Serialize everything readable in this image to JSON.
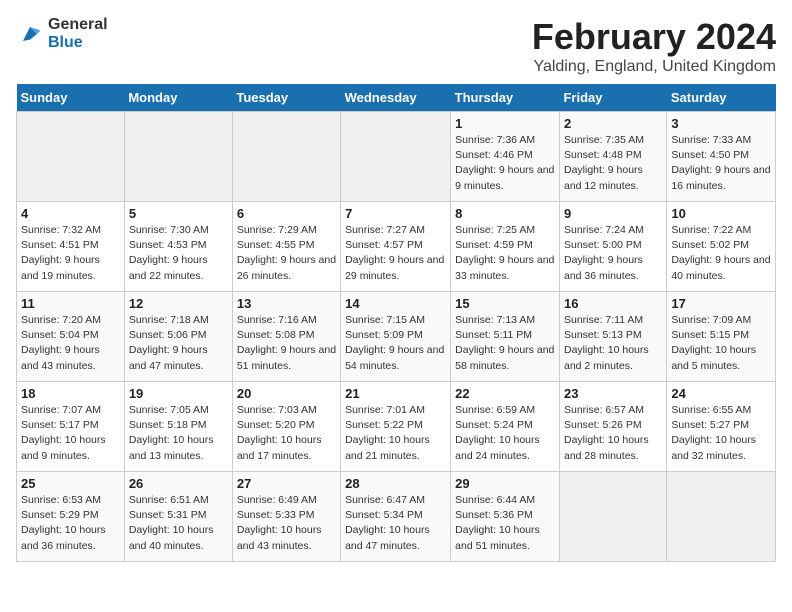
{
  "logo": {
    "line1": "General",
    "line2": "Blue"
  },
  "title": "February 2024",
  "subtitle": "Yalding, England, United Kingdom",
  "days_of_week": [
    "Sunday",
    "Monday",
    "Tuesday",
    "Wednesday",
    "Thursday",
    "Friday",
    "Saturday"
  ],
  "weeks": [
    [
      {
        "day": "",
        "info": ""
      },
      {
        "day": "",
        "info": ""
      },
      {
        "day": "",
        "info": ""
      },
      {
        "day": "",
        "info": ""
      },
      {
        "day": "1",
        "info": "Sunrise: 7:36 AM\nSunset: 4:46 PM\nDaylight: 9 hours and 9 minutes."
      },
      {
        "day": "2",
        "info": "Sunrise: 7:35 AM\nSunset: 4:48 PM\nDaylight: 9 hours and 12 minutes."
      },
      {
        "day": "3",
        "info": "Sunrise: 7:33 AM\nSunset: 4:50 PM\nDaylight: 9 hours and 16 minutes."
      }
    ],
    [
      {
        "day": "4",
        "info": "Sunrise: 7:32 AM\nSunset: 4:51 PM\nDaylight: 9 hours and 19 minutes."
      },
      {
        "day": "5",
        "info": "Sunrise: 7:30 AM\nSunset: 4:53 PM\nDaylight: 9 hours and 22 minutes."
      },
      {
        "day": "6",
        "info": "Sunrise: 7:29 AM\nSunset: 4:55 PM\nDaylight: 9 hours and 26 minutes."
      },
      {
        "day": "7",
        "info": "Sunrise: 7:27 AM\nSunset: 4:57 PM\nDaylight: 9 hours and 29 minutes."
      },
      {
        "day": "8",
        "info": "Sunrise: 7:25 AM\nSunset: 4:59 PM\nDaylight: 9 hours and 33 minutes."
      },
      {
        "day": "9",
        "info": "Sunrise: 7:24 AM\nSunset: 5:00 PM\nDaylight: 9 hours and 36 minutes."
      },
      {
        "day": "10",
        "info": "Sunrise: 7:22 AM\nSunset: 5:02 PM\nDaylight: 9 hours and 40 minutes."
      }
    ],
    [
      {
        "day": "11",
        "info": "Sunrise: 7:20 AM\nSunset: 5:04 PM\nDaylight: 9 hours and 43 minutes."
      },
      {
        "day": "12",
        "info": "Sunrise: 7:18 AM\nSunset: 5:06 PM\nDaylight: 9 hours and 47 minutes."
      },
      {
        "day": "13",
        "info": "Sunrise: 7:16 AM\nSunset: 5:08 PM\nDaylight: 9 hours and 51 minutes."
      },
      {
        "day": "14",
        "info": "Sunrise: 7:15 AM\nSunset: 5:09 PM\nDaylight: 9 hours and 54 minutes."
      },
      {
        "day": "15",
        "info": "Sunrise: 7:13 AM\nSunset: 5:11 PM\nDaylight: 9 hours and 58 minutes."
      },
      {
        "day": "16",
        "info": "Sunrise: 7:11 AM\nSunset: 5:13 PM\nDaylight: 10 hours and 2 minutes."
      },
      {
        "day": "17",
        "info": "Sunrise: 7:09 AM\nSunset: 5:15 PM\nDaylight: 10 hours and 5 minutes."
      }
    ],
    [
      {
        "day": "18",
        "info": "Sunrise: 7:07 AM\nSunset: 5:17 PM\nDaylight: 10 hours and 9 minutes."
      },
      {
        "day": "19",
        "info": "Sunrise: 7:05 AM\nSunset: 5:18 PM\nDaylight: 10 hours and 13 minutes."
      },
      {
        "day": "20",
        "info": "Sunrise: 7:03 AM\nSunset: 5:20 PM\nDaylight: 10 hours and 17 minutes."
      },
      {
        "day": "21",
        "info": "Sunrise: 7:01 AM\nSunset: 5:22 PM\nDaylight: 10 hours and 21 minutes."
      },
      {
        "day": "22",
        "info": "Sunrise: 6:59 AM\nSunset: 5:24 PM\nDaylight: 10 hours and 24 minutes."
      },
      {
        "day": "23",
        "info": "Sunrise: 6:57 AM\nSunset: 5:26 PM\nDaylight: 10 hours and 28 minutes."
      },
      {
        "day": "24",
        "info": "Sunrise: 6:55 AM\nSunset: 5:27 PM\nDaylight: 10 hours and 32 minutes."
      }
    ],
    [
      {
        "day": "25",
        "info": "Sunrise: 6:53 AM\nSunset: 5:29 PM\nDaylight: 10 hours and 36 minutes."
      },
      {
        "day": "26",
        "info": "Sunrise: 6:51 AM\nSunset: 5:31 PM\nDaylight: 10 hours and 40 minutes."
      },
      {
        "day": "27",
        "info": "Sunrise: 6:49 AM\nSunset: 5:33 PM\nDaylight: 10 hours and 43 minutes."
      },
      {
        "day": "28",
        "info": "Sunrise: 6:47 AM\nSunset: 5:34 PM\nDaylight: 10 hours and 47 minutes."
      },
      {
        "day": "29",
        "info": "Sunrise: 6:44 AM\nSunset: 5:36 PM\nDaylight: 10 hours and 51 minutes."
      },
      {
        "day": "",
        "info": ""
      },
      {
        "day": "",
        "info": ""
      }
    ]
  ]
}
